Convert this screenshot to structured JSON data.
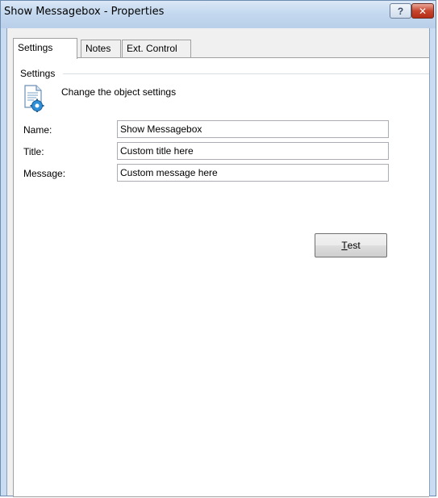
{
  "window": {
    "title": "Show Messagebox - Properties",
    "help_glyph": "?",
    "close_glyph": "✕"
  },
  "tabs": [
    {
      "label": "Settings",
      "active": true
    },
    {
      "label": "Notes",
      "active": false
    },
    {
      "label": "Ext. Control",
      "active": false
    }
  ],
  "settings": {
    "group_label": "Settings",
    "description": "Change the object settings",
    "icon": "document-gear-icon",
    "fields": {
      "name": {
        "label": "Name:",
        "value": "Show Messagebox"
      },
      "title": {
        "label": "Title:",
        "value": "Custom title here"
      },
      "message": {
        "label": "Message:",
        "value": "Custom message here"
      }
    },
    "test_button": {
      "mnemonic": "T",
      "rest": "est"
    }
  },
  "colors": {
    "titlebar": "#c4d8ef",
    "close_button": "#c7452e",
    "panel": "#ffffff"
  }
}
